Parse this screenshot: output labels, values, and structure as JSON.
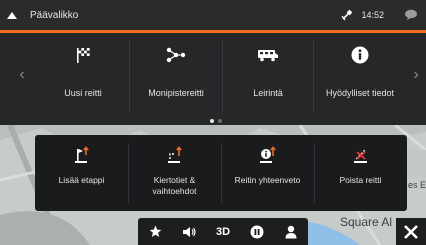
{
  "topbar": {
    "title": "Päävalikko",
    "time": "14:52"
  },
  "main_menu": {
    "items": [
      {
        "label": "Uusi reitti",
        "icon": "checkered-flag-icon"
      },
      {
        "label": "Monipistereitti",
        "icon": "multipoint-route-icon"
      },
      {
        "label": "Leirintä",
        "icon": "camper-van-icon"
      },
      {
        "label": "Hyödylliset tiedot",
        "icon": "info-circle-icon"
      }
    ],
    "page_indicator": {
      "current": 1,
      "total": 2
    }
  },
  "route_panel": {
    "items": [
      {
        "label": "Lisää etappi",
        "icon": "add-waypoint-icon"
      },
      {
        "label": "Kiertotiet & vaihtoehdot",
        "icon": "detour-icon"
      },
      {
        "label": "Reitin yhteenveto",
        "icon": "route-summary-icon"
      },
      {
        "label": "Poista reitti",
        "icon": "delete-route-icon"
      }
    ]
  },
  "map": {
    "labels": [
      "Square Al",
      "es E"
    ]
  },
  "bottom_bar": {
    "view_mode": "3D",
    "icons": [
      "star-icon",
      "volume-icon",
      "3d-toggle",
      "pause-icon",
      "person-icon"
    ]
  },
  "colors": {
    "accent": "#f26b1d",
    "panel": "#262729",
    "route_panel": "#1a1b1d"
  }
}
